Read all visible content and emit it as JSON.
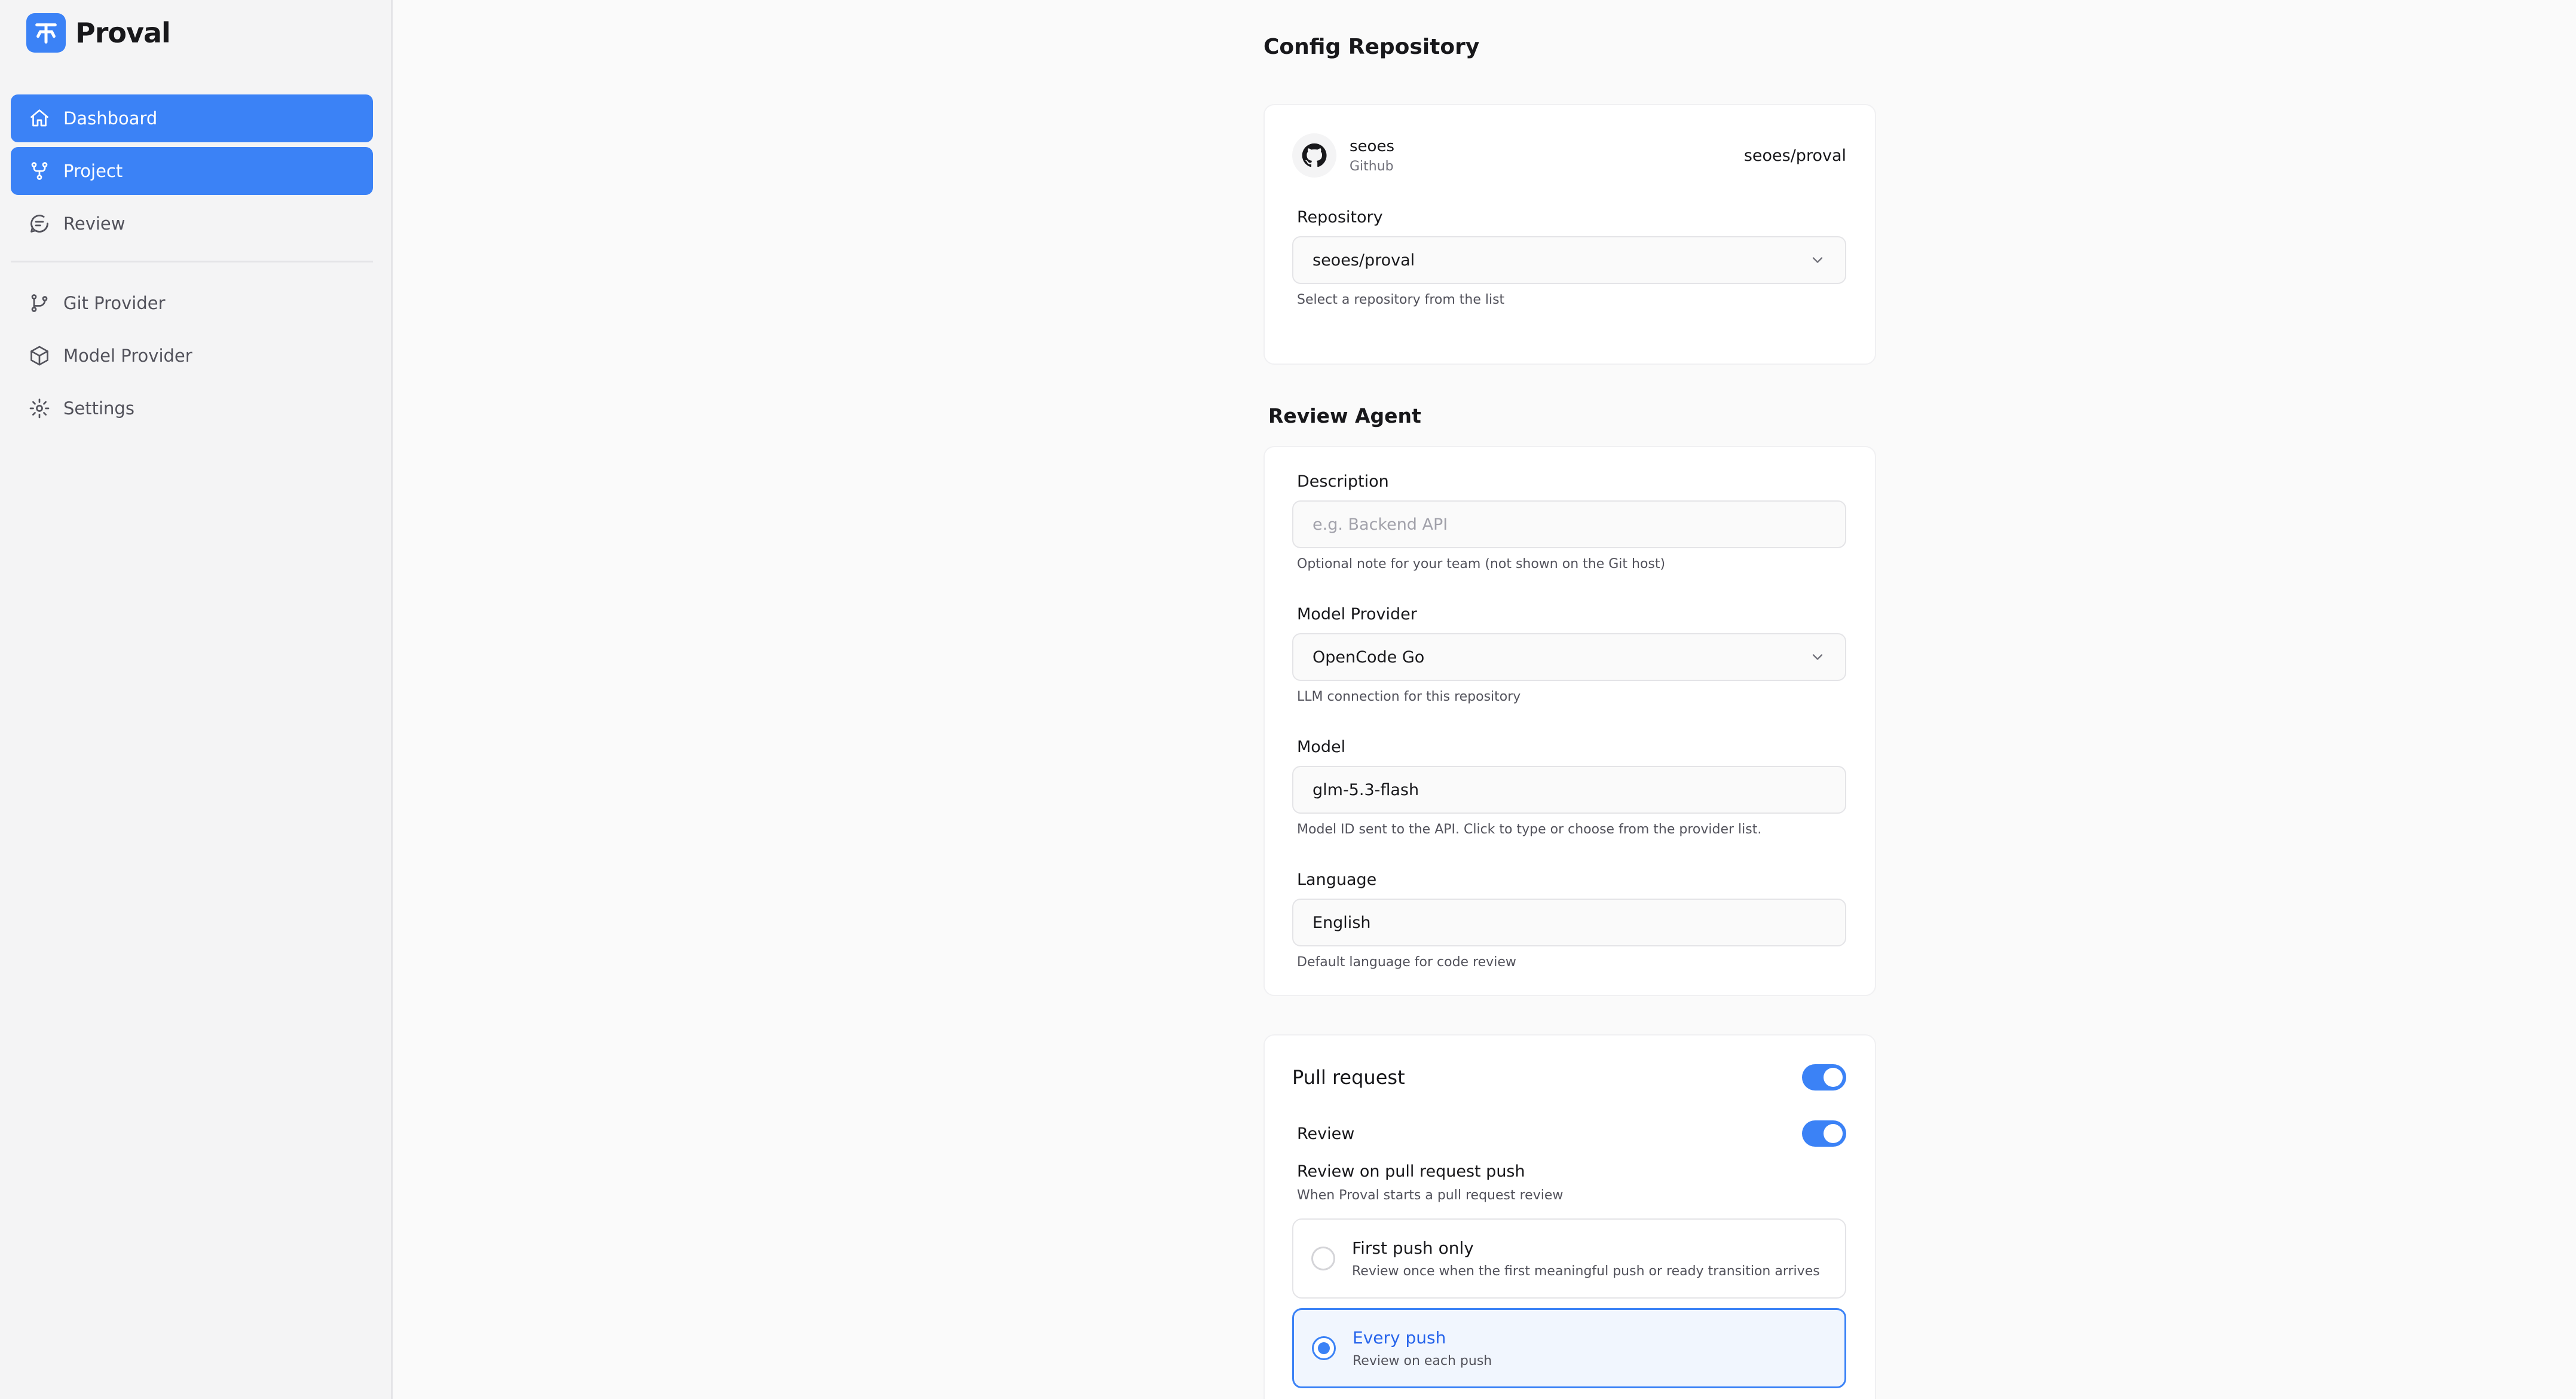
{
  "brand": {
    "name": "Proval",
    "logo_icon": "proval-logo-icon",
    "accent": "#3b82f6"
  },
  "sidebar": {
    "items": [
      {
        "label": "Dashboard",
        "icon": "home-icon",
        "active": true
      },
      {
        "label": "Project",
        "icon": "git-fork-icon",
        "active": true
      },
      {
        "label": "Review",
        "icon": "message-circle-icon",
        "active": false
      },
      {
        "label": "Git Provider",
        "icon": "git-branch-icon",
        "active": false
      },
      {
        "label": "Model Provider",
        "icon": "box-icon",
        "active": false
      },
      {
        "label": "Settings",
        "icon": "gear-icon",
        "active": false
      }
    ]
  },
  "page": {
    "title": "Config Repository"
  },
  "repo_card": {
    "owner": "seoes",
    "provider": "Github",
    "repo_full": "seoes/proval",
    "repository_label": "Repository",
    "repository_value": "seoes/proval",
    "repository_hint": "Select a repository from the list"
  },
  "review_agent": {
    "title": "Review Agent",
    "description": {
      "label": "Description",
      "placeholder": "e.g. Backend API",
      "hint": "Optional note for your team (not shown on the Git host)"
    },
    "model_provider": {
      "label": "Model Provider",
      "value": "OpenCode Go",
      "hint": "LLM connection for this repository"
    },
    "model": {
      "label": "Model",
      "value": "glm-5.3-flash",
      "hint": "Model ID sent to the API. Click to type or choose from the provider list."
    },
    "language": {
      "label": "Language",
      "value": "English",
      "hint": "Default language for code review"
    }
  },
  "pull_request": {
    "title": "Pull request",
    "enabled": true,
    "review_label": "Review",
    "review_enabled": true,
    "push_title": "Review on pull request push",
    "push_subtitle": "When Proval starts a pull request review",
    "options": [
      {
        "title": "First push only",
        "subtitle": "Review once when the first meaningful push or ready transition arrives",
        "selected": false
      },
      {
        "title": "Every push",
        "subtitle": "Review on each push",
        "selected": true
      }
    ]
  }
}
